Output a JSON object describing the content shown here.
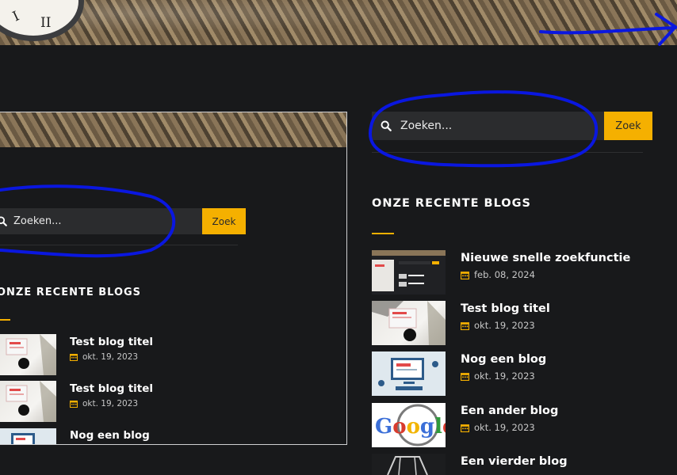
{
  "main_search": {
    "placeholder": "Zoeken...",
    "button_label": "Zoek"
  },
  "main_section_title": "ONZE RECENTE BLOGS",
  "main_posts": [
    {
      "title": "Nieuwe snelle zoekfunctie",
      "date": "feb. 08, 2024",
      "thumb": "search-screenshot"
    },
    {
      "title": "Test blog titel",
      "date": "okt. 19, 2023",
      "thumb": "laptop-desk"
    },
    {
      "title": "Nog een blog",
      "date": "okt. 19, 2023",
      "thumb": "blog-illustration"
    },
    {
      "title": "Een ander blog",
      "date": "okt. 19, 2023",
      "thumb": "google-magnifier"
    },
    {
      "title": "Een vierder blog",
      "date": "",
      "thumb": "dark-sketch"
    }
  ],
  "inner_search": {
    "placeholder": "Zoeken...",
    "button_label": "Zoek"
  },
  "inner_section_title": "ONZE RECENTE BLOGS",
  "inner_posts": [
    {
      "title": "Test blog titel",
      "date": "okt. 19, 2023"
    },
    {
      "title": "Test blog titel",
      "date": "okt. 19, 2023"
    },
    {
      "title": "Nog een blog",
      "date": ""
    }
  ],
  "clock_numerals": [
    "I",
    "II"
  ],
  "colors": {
    "accent": "#f5b000",
    "background": "#18191b",
    "annotation": "#0a17e0",
    "input": "#2b2c2e"
  }
}
